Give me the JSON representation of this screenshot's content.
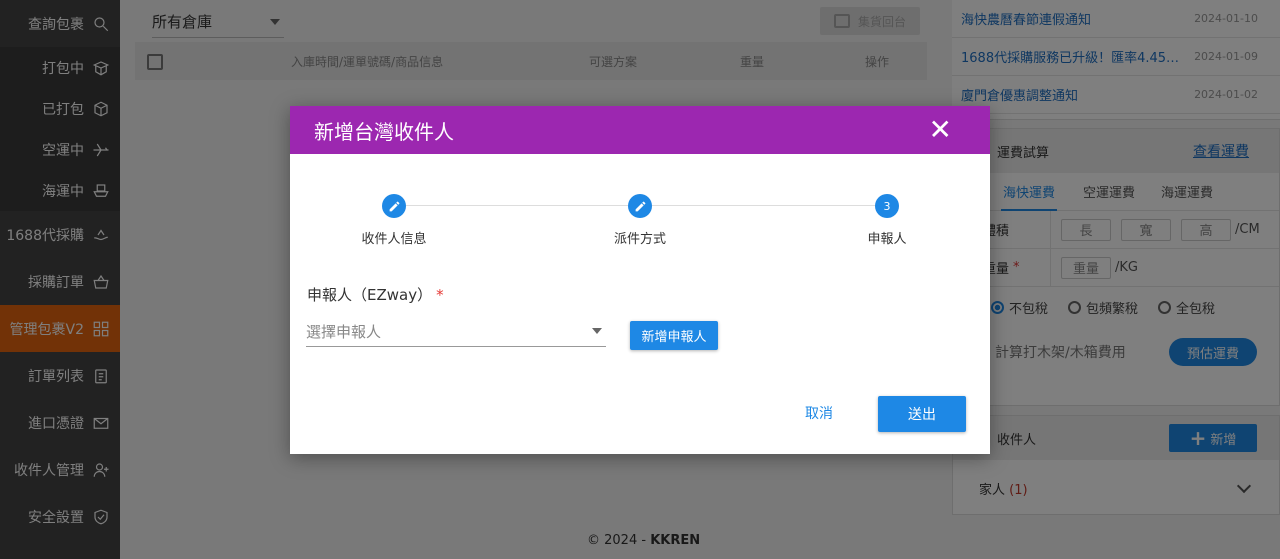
{
  "sidebar": {
    "items": [
      {
        "label": "查詢包裹",
        "icon": "search-icon"
      },
      {
        "label": "打包中",
        "icon": "box-open-icon"
      },
      {
        "label": "已打包",
        "icon": "box-icon"
      },
      {
        "label": "空運中",
        "icon": "plane-icon"
      },
      {
        "label": "海運中",
        "icon": "ship-icon"
      },
      {
        "label": "1688代採購",
        "icon": "shopping-hand-icon"
      },
      {
        "label": "採購訂單",
        "icon": "basket-icon"
      },
      {
        "label": "管理包裹V2",
        "icon": "grid-icon"
      },
      {
        "label": "訂單列表",
        "icon": "clipboard-icon"
      },
      {
        "label": "進口憑證",
        "icon": "envelope-icon"
      },
      {
        "label": "收件人管理",
        "icon": "user-add-icon"
      },
      {
        "label": "安全設置",
        "icon": "shield-icon"
      }
    ]
  },
  "main": {
    "warehouse_select": "所有倉庫",
    "consolidate_button": "集貨回台",
    "table_headers": {
      "info": "入庫時間/運單號碼/商品信息",
      "options": "可選方案",
      "weight": "重量",
      "action": "操作"
    },
    "footer": {
      "copyright": "© 2024 -",
      "brand": "KKREN"
    }
  },
  "news": [
    {
      "title": "海快農曆春節連假通知",
      "date": "2024-01-10"
    },
    {
      "title": "1688代採購服務已升級！匯率4.45…",
      "date": "2024-01-09"
    },
    {
      "title": "廈門倉優惠調整通知",
      "date": "2024-01-02"
    }
  ],
  "calculator": {
    "title": "運費試算",
    "view_link": "查看運費",
    "tabs": [
      "海快運費",
      "空運運費",
      "海運運費"
    ],
    "volume_label": "體積",
    "length_ph": "長",
    "width_ph": "寬",
    "height_ph": "高",
    "volume_unit": "/CM",
    "weight_label": "重量",
    "weight_ph": "重量",
    "weight_unit": "/KG",
    "radio_options": [
      "不包稅",
      "包頻繁稅",
      "全包稅"
    ],
    "crate_label": "計算打木架/木箱費用",
    "estimate_button": "預估運費"
  },
  "receivers": {
    "title": "收件人",
    "add_button": "新增",
    "group": "家人",
    "group_count": "(1)"
  },
  "modal": {
    "title": "新增台灣收件人",
    "steps": [
      {
        "label": "收件人信息",
        "number": ""
      },
      {
        "label": "派件方式",
        "number": ""
      },
      {
        "label": "申報人",
        "number": "3"
      }
    ],
    "field_label": "申報人（EZway）",
    "field_required": "*",
    "select_placeholder": "選擇申報人",
    "new_declarant_button": "新增申報人",
    "cancel_button": "取消",
    "submit_button": "送出"
  }
}
